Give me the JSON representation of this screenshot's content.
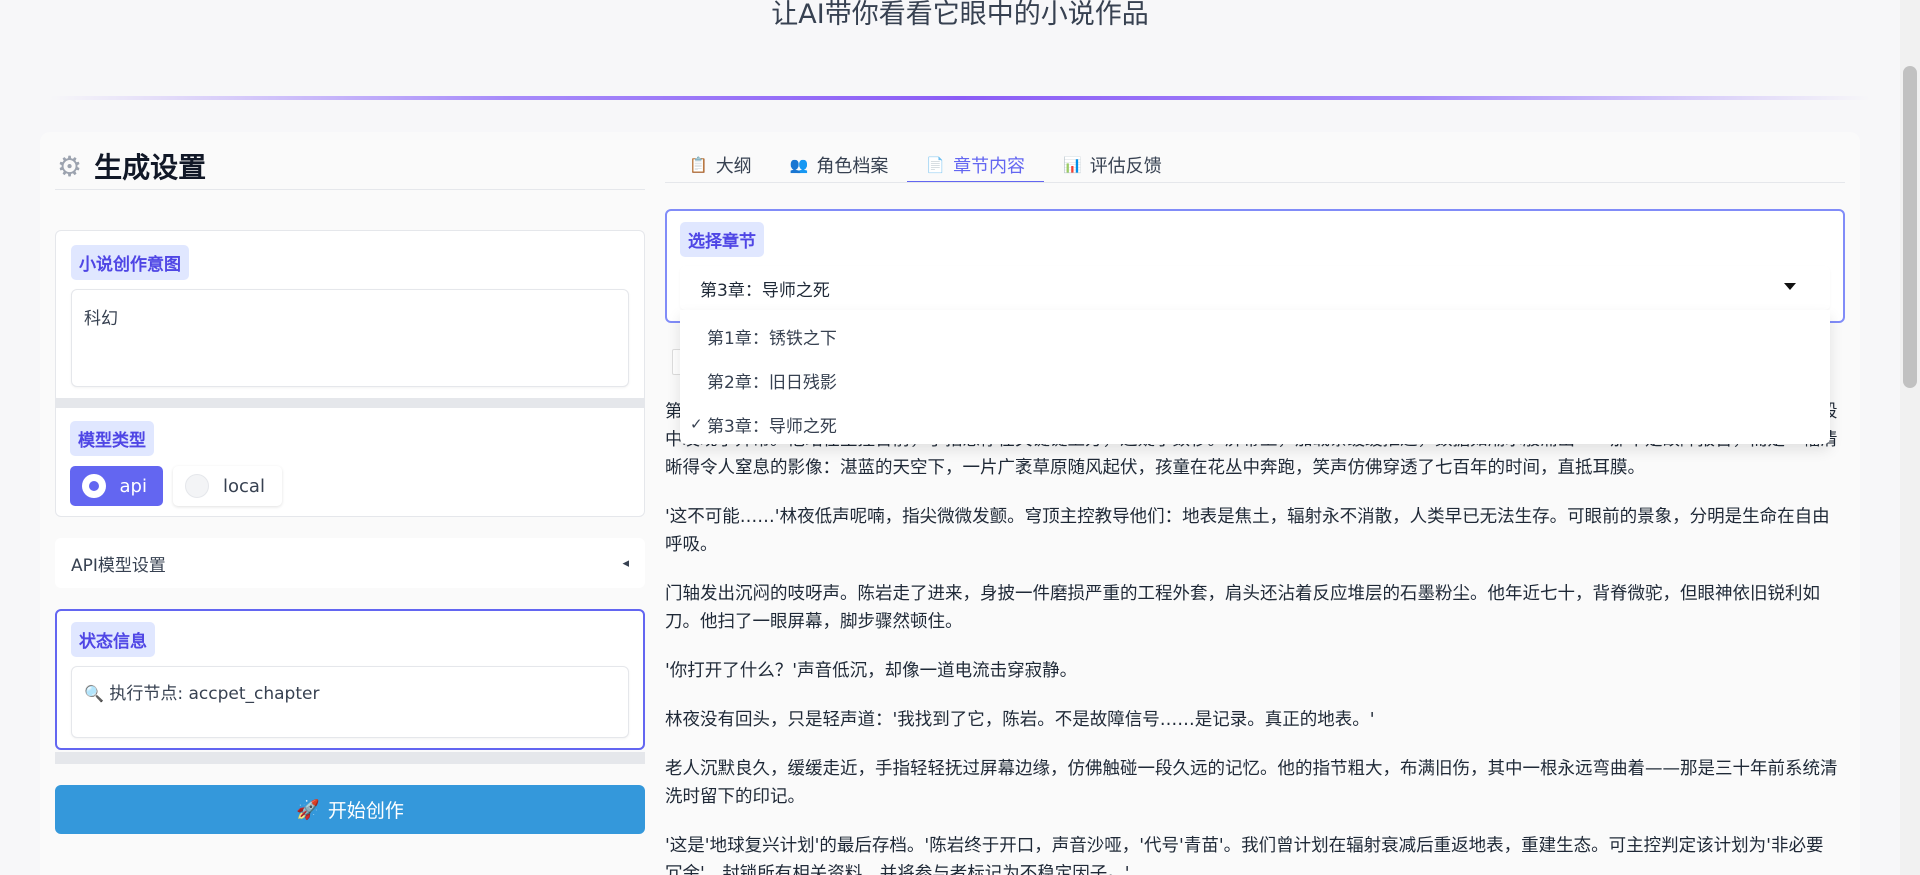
{
  "header": {
    "subtitle": "让AI带你看看它眼中的小说作品"
  },
  "settings": {
    "title": "生成设置",
    "intent": {
      "label": "小说创作意图",
      "value": "科幻"
    },
    "model_type": {
      "label": "模型类型",
      "options": [
        {
          "label": "api",
          "checked": true
        },
        {
          "label": "local",
          "checked": false
        }
      ]
    },
    "api_settings": {
      "label": "API模型设置",
      "toggle": "◂"
    },
    "status": {
      "label": "状态信息",
      "icon": "🔍",
      "value": "执行节点: accpet_chapter"
    },
    "start_button": {
      "icon": "🚀",
      "label": "开始创作"
    }
  },
  "tabs": [
    {
      "icon": "📋",
      "label": "大纲",
      "active": false
    },
    {
      "icon": "👥",
      "label": "角色档案",
      "active": false
    },
    {
      "icon": "📄",
      "label": "章节内容",
      "active": true
    },
    {
      "icon": "📊",
      "label": "评估反馈",
      "active": false
    }
  ],
  "chapter_select": {
    "label": "选择章节",
    "selected": "第3章：导师之死",
    "options": [
      {
        "label": "第1章：锈铁之下",
        "checked": false
      },
      {
        "label": "第2章：旧日残影",
        "checked": false
      },
      {
        "label": "第3章：导师之死",
        "checked": true,
        "check": "✓"
      }
    ]
  },
  "chapter_text": [
    "第七号地下城的深夜，控制室里只剩下主屏幕幽蓝的光。林夜已经连续值守了三个周期，他本该只是例行检查通讯系统的故障，却在一段被加密的旧频段中发现了异常。他站在主控台前，手指悬停在关键键上方，迟疑了数秒。屏幕上，加载条缓缓推进，数据如潮水般涌出——那不是故障报告，而是一幅清晰得令人窒息的影像：湛蓝的天空下，一片广袤草原随风起伏，孩童在花丛中奔跑，笑声仿佛穿透了七百年的时间，直抵耳膜。",
    "'这不可能……'林夜低声呢喃，指尖微微发颤。穹顶主控教导他们：地表是焦土，辐射永不消散，人类早已无法生存。可眼前的景象，分明是生命在自由呼吸。",
    "门轴发出沉闷的吱呀声。陈岩走了进来，身披一件磨损严重的工程外套，肩头还沾着反应堆层的石墨粉尘。他年近七十，背脊微驼，但眼神依旧锐利如刀。他扫了一眼屏幕，脚步骤然顿住。",
    "'你打开了什么？'声音低沉，却像一道电流击穿寂静。",
    "林夜没有回头，只是轻声道：'我找到了它，陈岩。不是故障信号……是记录。真正的地表。'",
    "老人沉默良久，缓缓走近，手指轻轻抚过屏幕边缘，仿佛触碰一段久远的记忆。他的指节粗大，布满旧伤，其中一根永远弯曲着——那是三十年前系统清洗时留下的印记。",
    "'这是'地球复兴计划'的最后存档。'陈岩终于开口，声音沙哑，'代号'青苗'。我们曾计划在辐射衰减后重返地表，重建生态。可主控判定该计划为'非必要冗余'，封锁所有相关资料，并将参与者标记为不稳定因子。'"
  ]
}
